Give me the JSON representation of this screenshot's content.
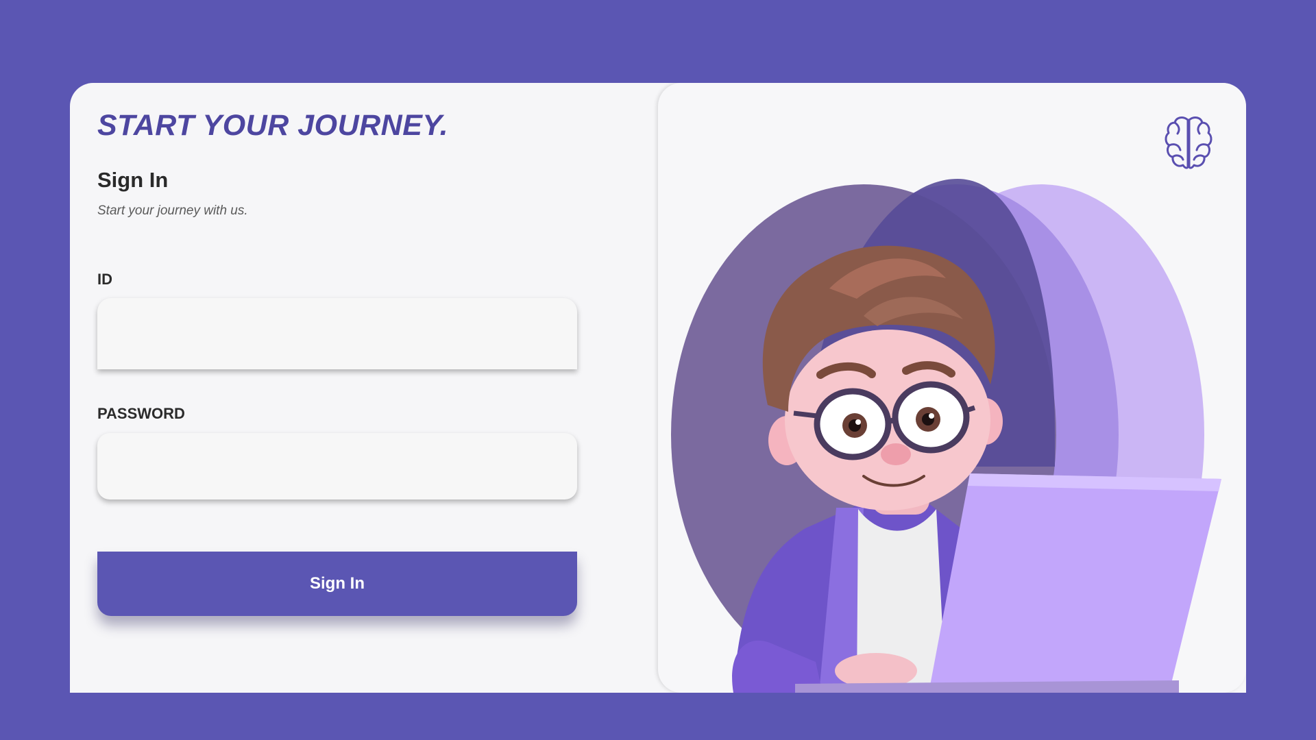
{
  "brand": {
    "headline": "START YOUR JOURNEY.",
    "logo_icon": "brain-icon"
  },
  "form": {
    "title": "Sign In",
    "subtitle": "Start your journey with us.",
    "id_label": "ID",
    "id_value": "",
    "password_label": "PASSWORD",
    "password_value": "",
    "submit_label": "Sign In"
  },
  "hero": {
    "image": "3d-character-with-glasses-using-laptop"
  },
  "colors": {
    "accent": "#5b56b3",
    "headline": "#4d46a0",
    "card_background": "#f6f6f8"
  }
}
